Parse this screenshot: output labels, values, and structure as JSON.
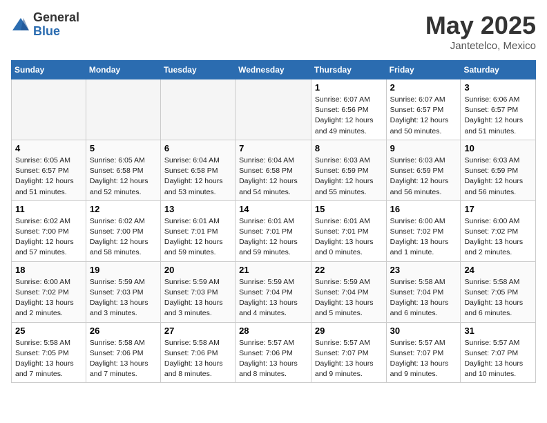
{
  "logo": {
    "general": "General",
    "blue": "Blue"
  },
  "header": {
    "month": "May 2025",
    "location": "Jantetelco, Mexico"
  },
  "weekdays": [
    "Sunday",
    "Monday",
    "Tuesday",
    "Wednesday",
    "Thursday",
    "Friday",
    "Saturday"
  ],
  "weeks": [
    [
      {
        "day": "",
        "info": ""
      },
      {
        "day": "",
        "info": ""
      },
      {
        "day": "",
        "info": ""
      },
      {
        "day": "",
        "info": ""
      },
      {
        "day": "1",
        "info": "Sunrise: 6:07 AM\nSunset: 6:56 PM\nDaylight: 12 hours\nand 49 minutes."
      },
      {
        "day": "2",
        "info": "Sunrise: 6:07 AM\nSunset: 6:57 PM\nDaylight: 12 hours\nand 50 minutes."
      },
      {
        "day": "3",
        "info": "Sunrise: 6:06 AM\nSunset: 6:57 PM\nDaylight: 12 hours\nand 51 minutes."
      }
    ],
    [
      {
        "day": "4",
        "info": "Sunrise: 6:05 AM\nSunset: 6:57 PM\nDaylight: 12 hours\nand 51 minutes."
      },
      {
        "day": "5",
        "info": "Sunrise: 6:05 AM\nSunset: 6:58 PM\nDaylight: 12 hours\nand 52 minutes."
      },
      {
        "day": "6",
        "info": "Sunrise: 6:04 AM\nSunset: 6:58 PM\nDaylight: 12 hours\nand 53 minutes."
      },
      {
        "day": "7",
        "info": "Sunrise: 6:04 AM\nSunset: 6:58 PM\nDaylight: 12 hours\nand 54 minutes."
      },
      {
        "day": "8",
        "info": "Sunrise: 6:03 AM\nSunset: 6:59 PM\nDaylight: 12 hours\nand 55 minutes."
      },
      {
        "day": "9",
        "info": "Sunrise: 6:03 AM\nSunset: 6:59 PM\nDaylight: 12 hours\nand 56 minutes."
      },
      {
        "day": "10",
        "info": "Sunrise: 6:03 AM\nSunset: 6:59 PM\nDaylight: 12 hours\nand 56 minutes."
      }
    ],
    [
      {
        "day": "11",
        "info": "Sunrise: 6:02 AM\nSunset: 7:00 PM\nDaylight: 12 hours\nand 57 minutes."
      },
      {
        "day": "12",
        "info": "Sunrise: 6:02 AM\nSunset: 7:00 PM\nDaylight: 12 hours\nand 58 minutes."
      },
      {
        "day": "13",
        "info": "Sunrise: 6:01 AM\nSunset: 7:01 PM\nDaylight: 12 hours\nand 59 minutes."
      },
      {
        "day": "14",
        "info": "Sunrise: 6:01 AM\nSunset: 7:01 PM\nDaylight: 12 hours\nand 59 minutes."
      },
      {
        "day": "15",
        "info": "Sunrise: 6:01 AM\nSunset: 7:01 PM\nDaylight: 13 hours\nand 0 minutes."
      },
      {
        "day": "16",
        "info": "Sunrise: 6:00 AM\nSunset: 7:02 PM\nDaylight: 13 hours\nand 1 minute."
      },
      {
        "day": "17",
        "info": "Sunrise: 6:00 AM\nSunset: 7:02 PM\nDaylight: 13 hours\nand 2 minutes."
      }
    ],
    [
      {
        "day": "18",
        "info": "Sunrise: 6:00 AM\nSunset: 7:02 PM\nDaylight: 13 hours\nand 2 minutes."
      },
      {
        "day": "19",
        "info": "Sunrise: 5:59 AM\nSunset: 7:03 PM\nDaylight: 13 hours\nand 3 minutes."
      },
      {
        "day": "20",
        "info": "Sunrise: 5:59 AM\nSunset: 7:03 PM\nDaylight: 13 hours\nand 3 minutes."
      },
      {
        "day": "21",
        "info": "Sunrise: 5:59 AM\nSunset: 7:04 PM\nDaylight: 13 hours\nand 4 minutes."
      },
      {
        "day": "22",
        "info": "Sunrise: 5:59 AM\nSunset: 7:04 PM\nDaylight: 13 hours\nand 5 minutes."
      },
      {
        "day": "23",
        "info": "Sunrise: 5:58 AM\nSunset: 7:04 PM\nDaylight: 13 hours\nand 6 minutes."
      },
      {
        "day": "24",
        "info": "Sunrise: 5:58 AM\nSunset: 7:05 PM\nDaylight: 13 hours\nand 6 minutes."
      }
    ],
    [
      {
        "day": "25",
        "info": "Sunrise: 5:58 AM\nSunset: 7:05 PM\nDaylight: 13 hours\nand 7 minutes."
      },
      {
        "day": "26",
        "info": "Sunrise: 5:58 AM\nSunset: 7:06 PM\nDaylight: 13 hours\nand 7 minutes."
      },
      {
        "day": "27",
        "info": "Sunrise: 5:58 AM\nSunset: 7:06 PM\nDaylight: 13 hours\nand 8 minutes."
      },
      {
        "day": "28",
        "info": "Sunrise: 5:57 AM\nSunset: 7:06 PM\nDaylight: 13 hours\nand 8 minutes."
      },
      {
        "day": "29",
        "info": "Sunrise: 5:57 AM\nSunset: 7:07 PM\nDaylight: 13 hours\nand 9 minutes."
      },
      {
        "day": "30",
        "info": "Sunrise: 5:57 AM\nSunset: 7:07 PM\nDaylight: 13 hours\nand 9 minutes."
      },
      {
        "day": "31",
        "info": "Sunrise: 5:57 AM\nSunset: 7:07 PM\nDaylight: 13 hours\nand 10 minutes."
      }
    ]
  ]
}
